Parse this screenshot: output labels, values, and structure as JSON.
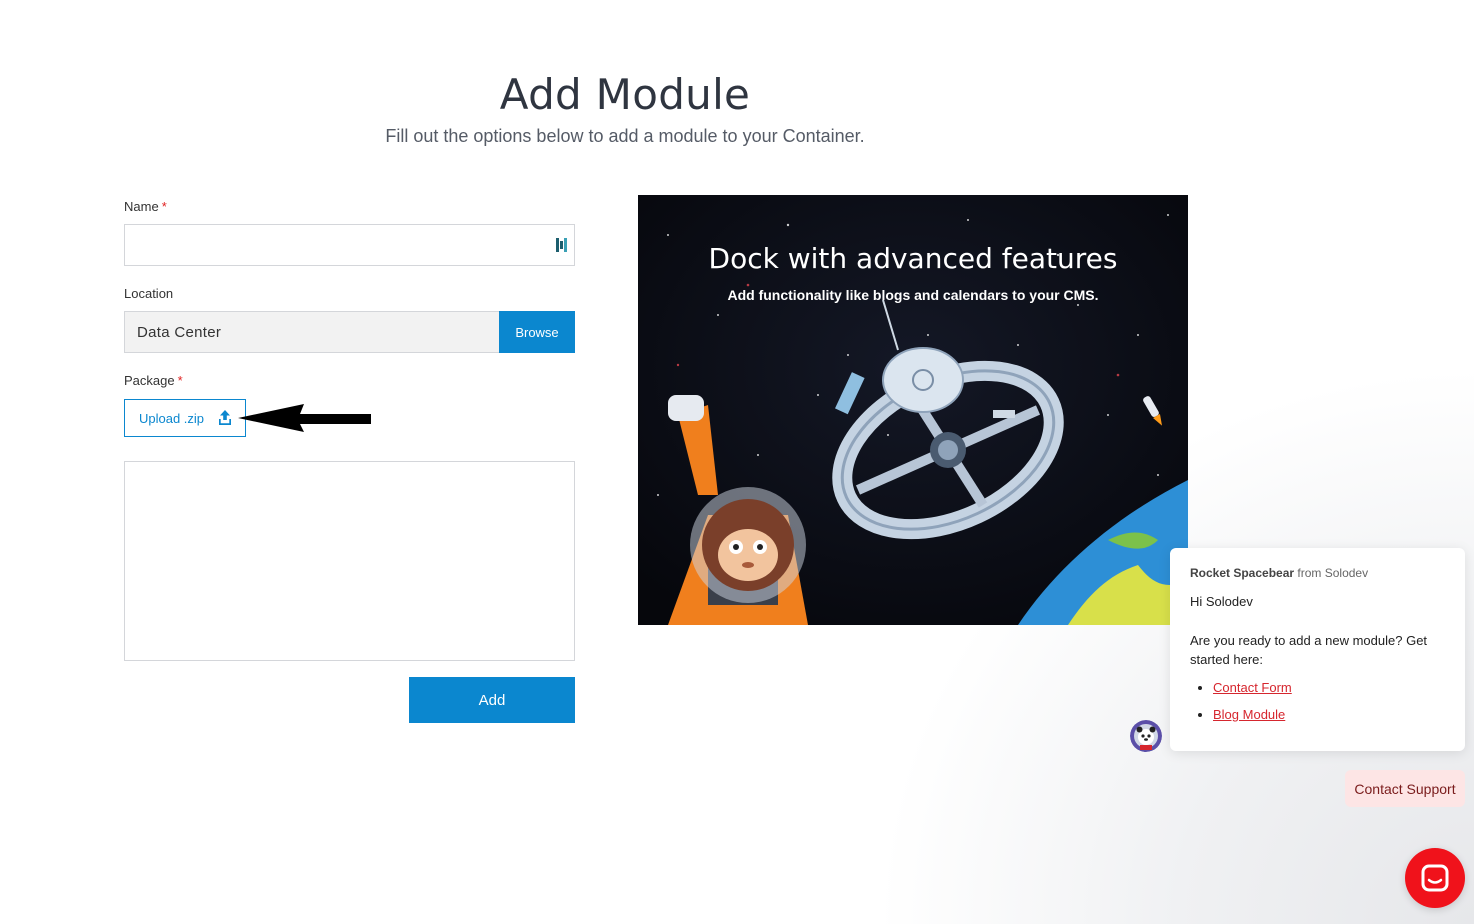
{
  "header": {
    "title": "Add Module",
    "subtitle": "Fill out the options below to add a module to your Container."
  },
  "form": {
    "name_label": "Name",
    "required_mark": "*",
    "name_value": "",
    "location_label": "Location",
    "location_value": "Data Center",
    "browse_label": "Browse",
    "package_label": "Package",
    "upload_label": "Upload .zip",
    "add_label": "Add"
  },
  "promo": {
    "title": "Dock with advanced features",
    "subtitle": "Add functionality like blogs and calendars to your CMS."
  },
  "chat": {
    "agent_name": "Rocket Spacebear",
    "from_text": "from Solodev",
    "greeting": "Hi Solodev",
    "message": "Are you ready to add a new module? Get started here:",
    "links": [
      {
        "label": "Contact Form"
      },
      {
        "label": "Blog Module"
      }
    ],
    "contact_support_label": "Contact Support"
  },
  "colors": {
    "accent": "#0b87cf",
    "chat_link": "#d6262e",
    "launcher": "#f0121b"
  },
  "icons": {
    "upload": "upload-icon",
    "password_manager": "password-manager-icon",
    "chat_launcher": "chat-launcher-icon"
  }
}
